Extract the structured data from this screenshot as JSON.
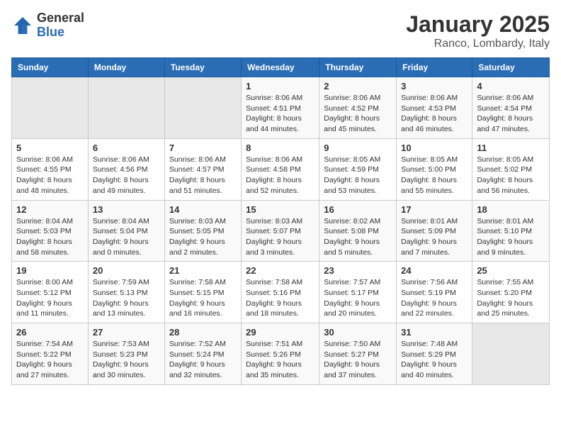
{
  "header": {
    "logo_general": "General",
    "logo_blue": "Blue",
    "title": "January 2025",
    "subtitle": "Ranco, Lombardy, Italy"
  },
  "weekdays": [
    "Sunday",
    "Monday",
    "Tuesday",
    "Wednesday",
    "Thursday",
    "Friday",
    "Saturday"
  ],
  "weeks": [
    [
      {
        "day": "",
        "empty": true
      },
      {
        "day": "",
        "empty": true
      },
      {
        "day": "",
        "empty": true
      },
      {
        "day": "1",
        "sunrise": "8:06 AM",
        "sunset": "4:51 PM",
        "daylight": "8 hours and 44 minutes."
      },
      {
        "day": "2",
        "sunrise": "8:06 AM",
        "sunset": "4:52 PM",
        "daylight": "8 hours and 45 minutes."
      },
      {
        "day": "3",
        "sunrise": "8:06 AM",
        "sunset": "4:53 PM",
        "daylight": "8 hours and 46 minutes."
      },
      {
        "day": "4",
        "sunrise": "8:06 AM",
        "sunset": "4:54 PM",
        "daylight": "8 hours and 47 minutes."
      }
    ],
    [
      {
        "day": "5",
        "sunrise": "8:06 AM",
        "sunset": "4:55 PM",
        "daylight": "8 hours and 48 minutes."
      },
      {
        "day": "6",
        "sunrise": "8:06 AM",
        "sunset": "4:56 PM",
        "daylight": "8 hours and 49 minutes."
      },
      {
        "day": "7",
        "sunrise": "8:06 AM",
        "sunset": "4:57 PM",
        "daylight": "8 hours and 51 minutes."
      },
      {
        "day": "8",
        "sunrise": "8:06 AM",
        "sunset": "4:58 PM",
        "daylight": "8 hours and 52 minutes."
      },
      {
        "day": "9",
        "sunrise": "8:05 AM",
        "sunset": "4:59 PM",
        "daylight": "8 hours and 53 minutes."
      },
      {
        "day": "10",
        "sunrise": "8:05 AM",
        "sunset": "5:00 PM",
        "daylight": "8 hours and 55 minutes."
      },
      {
        "day": "11",
        "sunrise": "8:05 AM",
        "sunset": "5:02 PM",
        "daylight": "8 hours and 56 minutes."
      }
    ],
    [
      {
        "day": "12",
        "sunrise": "8:04 AM",
        "sunset": "5:03 PM",
        "daylight": "8 hours and 58 minutes."
      },
      {
        "day": "13",
        "sunrise": "8:04 AM",
        "sunset": "5:04 PM",
        "daylight": "9 hours and 0 minutes."
      },
      {
        "day": "14",
        "sunrise": "8:03 AM",
        "sunset": "5:05 PM",
        "daylight": "9 hours and 2 minutes."
      },
      {
        "day": "15",
        "sunrise": "8:03 AM",
        "sunset": "5:07 PM",
        "daylight": "9 hours and 3 minutes."
      },
      {
        "day": "16",
        "sunrise": "8:02 AM",
        "sunset": "5:08 PM",
        "daylight": "9 hours and 5 minutes."
      },
      {
        "day": "17",
        "sunrise": "8:01 AM",
        "sunset": "5:09 PM",
        "daylight": "9 hours and 7 minutes."
      },
      {
        "day": "18",
        "sunrise": "8:01 AM",
        "sunset": "5:10 PM",
        "daylight": "9 hours and 9 minutes."
      }
    ],
    [
      {
        "day": "19",
        "sunrise": "8:00 AM",
        "sunset": "5:12 PM",
        "daylight": "9 hours and 11 minutes."
      },
      {
        "day": "20",
        "sunrise": "7:59 AM",
        "sunset": "5:13 PM",
        "daylight": "9 hours and 13 minutes."
      },
      {
        "day": "21",
        "sunrise": "7:58 AM",
        "sunset": "5:15 PM",
        "daylight": "9 hours and 16 minutes."
      },
      {
        "day": "22",
        "sunrise": "7:58 AM",
        "sunset": "5:16 PM",
        "daylight": "9 hours and 18 minutes."
      },
      {
        "day": "23",
        "sunrise": "7:57 AM",
        "sunset": "5:17 PM",
        "daylight": "9 hours and 20 minutes."
      },
      {
        "day": "24",
        "sunrise": "7:56 AM",
        "sunset": "5:19 PM",
        "daylight": "9 hours and 22 minutes."
      },
      {
        "day": "25",
        "sunrise": "7:55 AM",
        "sunset": "5:20 PM",
        "daylight": "9 hours and 25 minutes."
      }
    ],
    [
      {
        "day": "26",
        "sunrise": "7:54 AM",
        "sunset": "5:22 PM",
        "daylight": "9 hours and 27 minutes."
      },
      {
        "day": "27",
        "sunrise": "7:53 AM",
        "sunset": "5:23 PM",
        "daylight": "9 hours and 30 minutes."
      },
      {
        "day": "28",
        "sunrise": "7:52 AM",
        "sunset": "5:24 PM",
        "daylight": "9 hours and 32 minutes."
      },
      {
        "day": "29",
        "sunrise": "7:51 AM",
        "sunset": "5:26 PM",
        "daylight": "9 hours and 35 minutes."
      },
      {
        "day": "30",
        "sunrise": "7:50 AM",
        "sunset": "5:27 PM",
        "daylight": "9 hours and 37 minutes."
      },
      {
        "day": "31",
        "sunrise": "7:48 AM",
        "sunset": "5:29 PM",
        "daylight": "9 hours and 40 minutes."
      },
      {
        "day": "",
        "empty": true
      }
    ]
  ],
  "labels": {
    "sunrise": "Sunrise: ",
    "sunset": "Sunset: ",
    "daylight": "Daylight: "
  }
}
